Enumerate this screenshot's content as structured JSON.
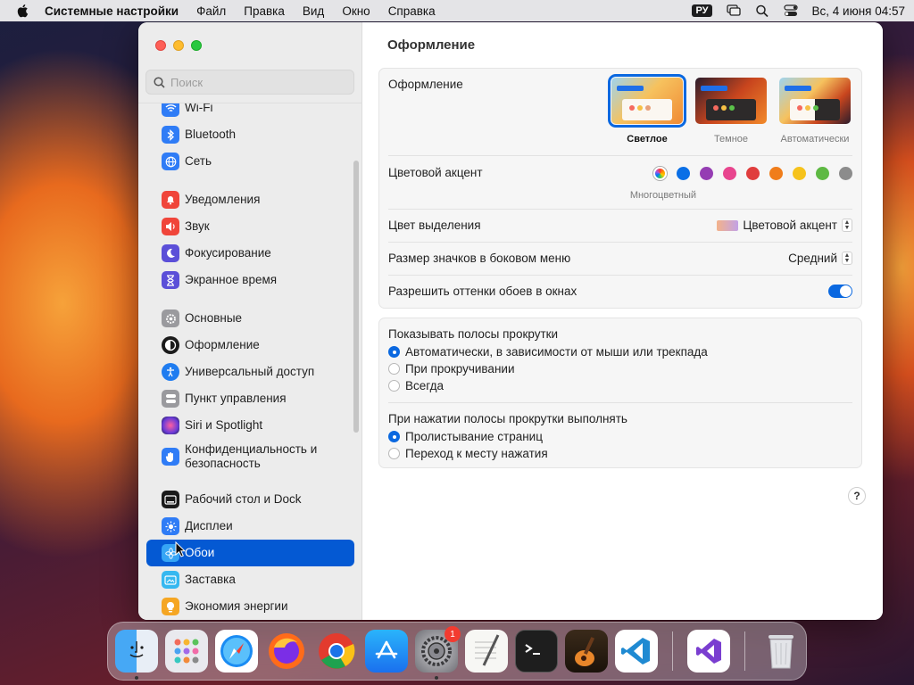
{
  "menubar": {
    "app": "Системные настройки",
    "items": [
      "Файл",
      "Правка",
      "Вид",
      "Окно",
      "Справка"
    ],
    "input_source": "РУ",
    "datetime": "Вс, 4 июня  04:57"
  },
  "sidebar": {
    "search_placeholder": "Поиск",
    "items": [
      {
        "label": "Wi-Fi",
        "icon": "wifi-icon",
        "color": "#2f7cf6"
      },
      {
        "label": "Bluetooth",
        "icon": "bluetooth-icon",
        "color": "#2f7cf6"
      },
      {
        "label": "Сеть",
        "icon": "globe-icon",
        "color": "#2f7cf6"
      },
      {
        "label": "Уведомления",
        "icon": "bell-icon",
        "color": "#f0453a"
      },
      {
        "label": "Звук",
        "icon": "speaker-icon",
        "color": "#f0453a"
      },
      {
        "label": "Фокусирование",
        "icon": "moon-icon",
        "color": "#5b4fd8"
      },
      {
        "label": "Экранное время",
        "icon": "hourglass-icon",
        "color": "#5b4fd8"
      },
      {
        "label": "Основные",
        "icon": "gear-icon",
        "color": "#9a9a9e"
      },
      {
        "label": "Оформление",
        "icon": "appearance-icon",
        "color": "#1b1b1b"
      },
      {
        "label": "Универсальный доступ",
        "icon": "accessibility-icon",
        "color": "#1f7cf0"
      },
      {
        "label": "Пункт управления",
        "icon": "control-center-icon",
        "color": "#9a9a9e"
      },
      {
        "label": "Siri и Spotlight",
        "icon": "siri-icon",
        "color": "#b43acb"
      },
      {
        "label": "Конфиденциальность и безопасность",
        "icon": "hand-icon",
        "color": "#2f7cf6"
      },
      {
        "label": "Рабочий стол и Dock",
        "icon": "dock-icon",
        "color": "#1b1b1b"
      },
      {
        "label": "Дисплеи",
        "icon": "sun-icon",
        "color": "#2f7cf6"
      },
      {
        "label": "Обои",
        "icon": "flower-icon",
        "color": "#36a5f5"
      },
      {
        "label": "Заставка",
        "icon": "screensaver-icon",
        "color": "#36b8f0"
      },
      {
        "label": "Экономия энергии",
        "icon": "bulb-icon",
        "color": "#f5a623"
      }
    ]
  },
  "main": {
    "title": "Оформление",
    "appearance_label": "Оформление",
    "appearance_options": [
      "Светлое",
      "Темное",
      "Автоматически"
    ],
    "accent_label": "Цветовой акцент",
    "accent_colors": [
      "#0a6fe6",
      "#953db3",
      "#e8458e",
      "#e03d3d",
      "#f07d1a",
      "#f6c31c",
      "#5eb943",
      "#8c8c8c"
    ],
    "accent_selected": "Многоцветный",
    "highlight_label": "Цвет выделения",
    "highlight_value": "Цветовой акцент",
    "sidebar_icon_label": "Размер значков в боковом меню",
    "sidebar_icon_value": "Средний",
    "tint_label": "Разрешить оттенки обоев в окнах",
    "scroll_show_label": "Показывать полосы прокрутки",
    "scroll_show_options": [
      "Автоматически, в зависимости от мыши или трекпада",
      "При прокручивании",
      "Всегда"
    ],
    "scroll_click_label": "При нажатии полосы прокрутки выполнять",
    "scroll_click_options": [
      "Пролистывание страниц",
      "Переход к месту нажатия"
    ],
    "help": "?"
  },
  "dock": {
    "settings_badge": "1"
  }
}
